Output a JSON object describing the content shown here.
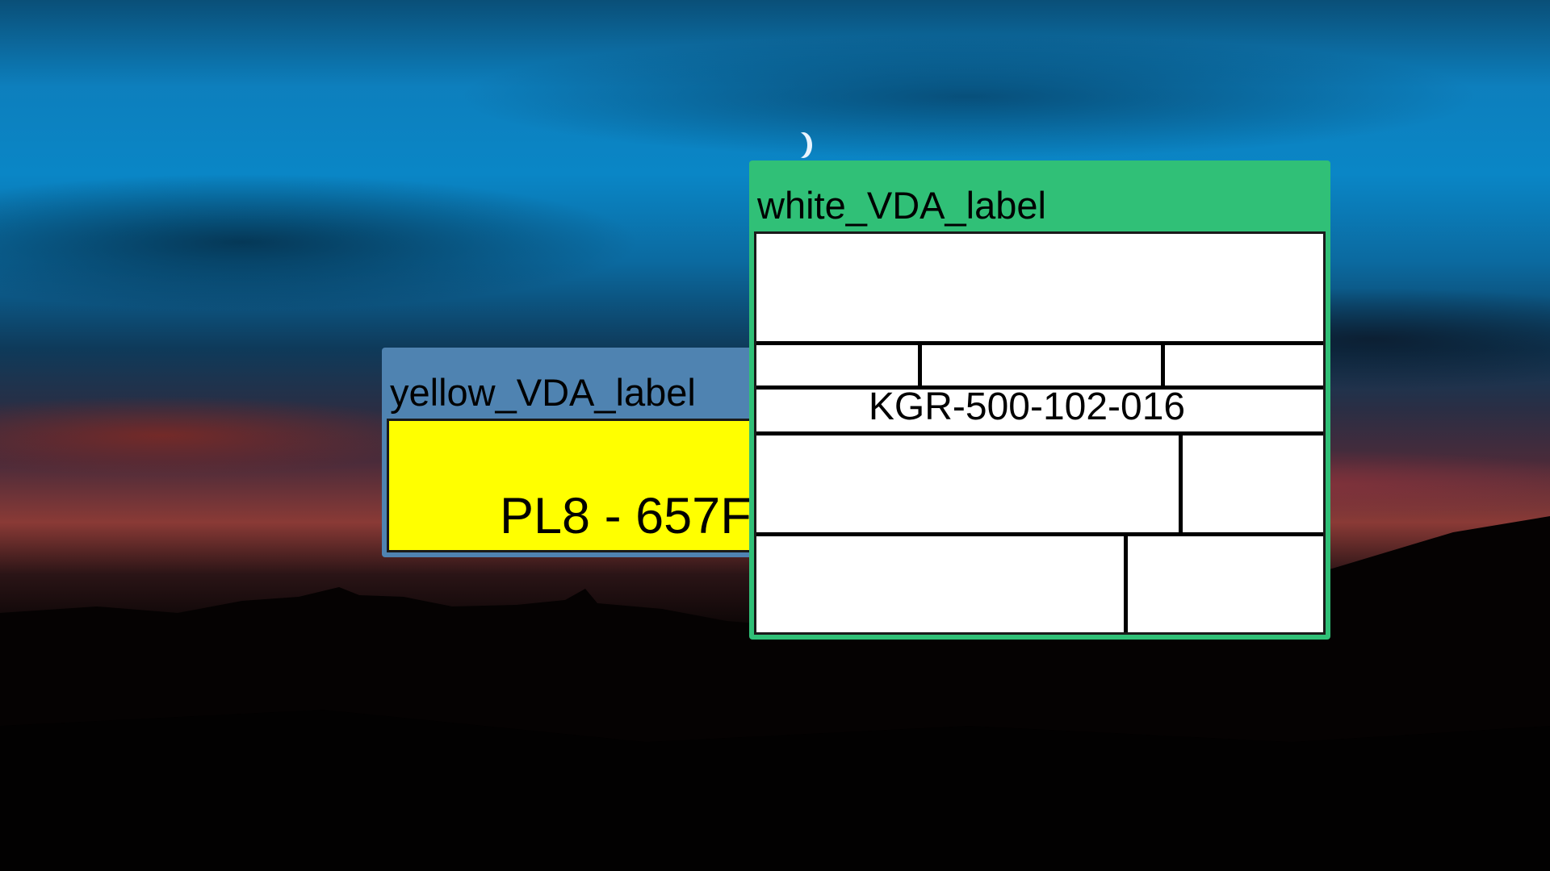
{
  "desktop": {
    "background": "night sky wallpaper"
  },
  "windows": {
    "yellow": {
      "title": "yellow_VDA_label",
      "plate_text": "PL8 - 657F",
      "titlebar_color": "#4f83b1",
      "content_color": "#ffff00"
    },
    "white": {
      "title": "white_VDA_label",
      "part_number": "KGR-500-102-016",
      "titlebar_color": "#30c077",
      "content_color": "#ffffff"
    }
  }
}
